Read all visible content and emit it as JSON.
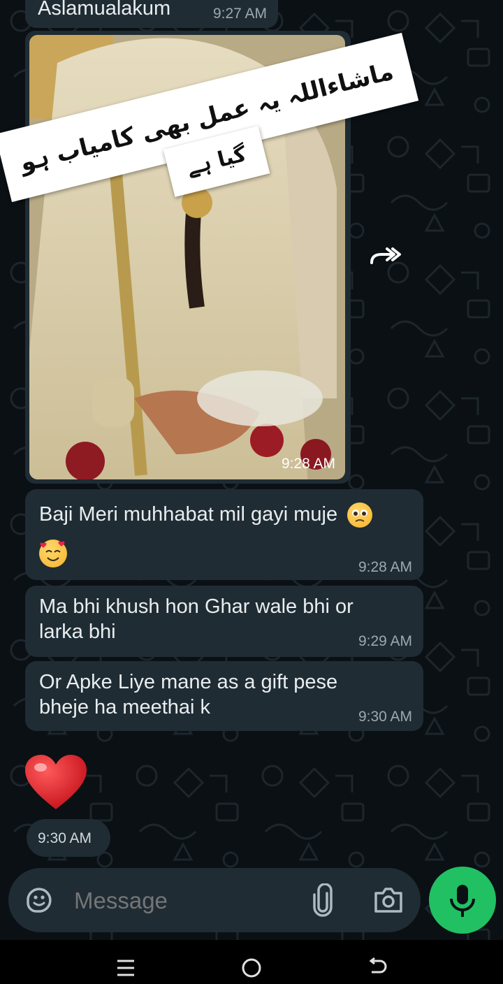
{
  "colors": {
    "background": "#0b1014",
    "bubble": "#1f2c34",
    "accent_green": "#21c063",
    "timestamp": "#9fa8ad"
  },
  "messages": {
    "top_partial": {
      "text": "Aslamualakum",
      "time": "9:27 AM"
    },
    "image_message": {
      "time": "9:28 AM",
      "caption_line1": "ماشاءاللہ یہ عمل بھی کامیاب ہو",
      "caption_line2": "گیا ہے"
    },
    "text1": {
      "text": "Baji Meri muhhabat mil gayi muje",
      "emojis": [
        "crying-face-emoji",
        "smiling-face-with-hearts-emoji"
      ],
      "time": "9:28 AM"
    },
    "text2": {
      "line1": "Ma bhi khush hon Ghar wale bhi or",
      "line2": "larka bhi",
      "time": "9:29 AM"
    },
    "text3": {
      "line1": "Or Apke Liye mane as a gift pese",
      "line2": "bheje ha meethai k",
      "time": "9:30 AM"
    },
    "heart": {
      "icon": "red-heart-emoji",
      "time": "9:30 AM"
    }
  },
  "composer": {
    "placeholder": "Message",
    "icons": [
      "sticker-icon",
      "attach-icon",
      "camera-icon",
      "mic-icon"
    ]
  },
  "navigation_bar": {
    "icons": [
      "recent-apps-icon",
      "home-icon",
      "back-icon"
    ]
  }
}
